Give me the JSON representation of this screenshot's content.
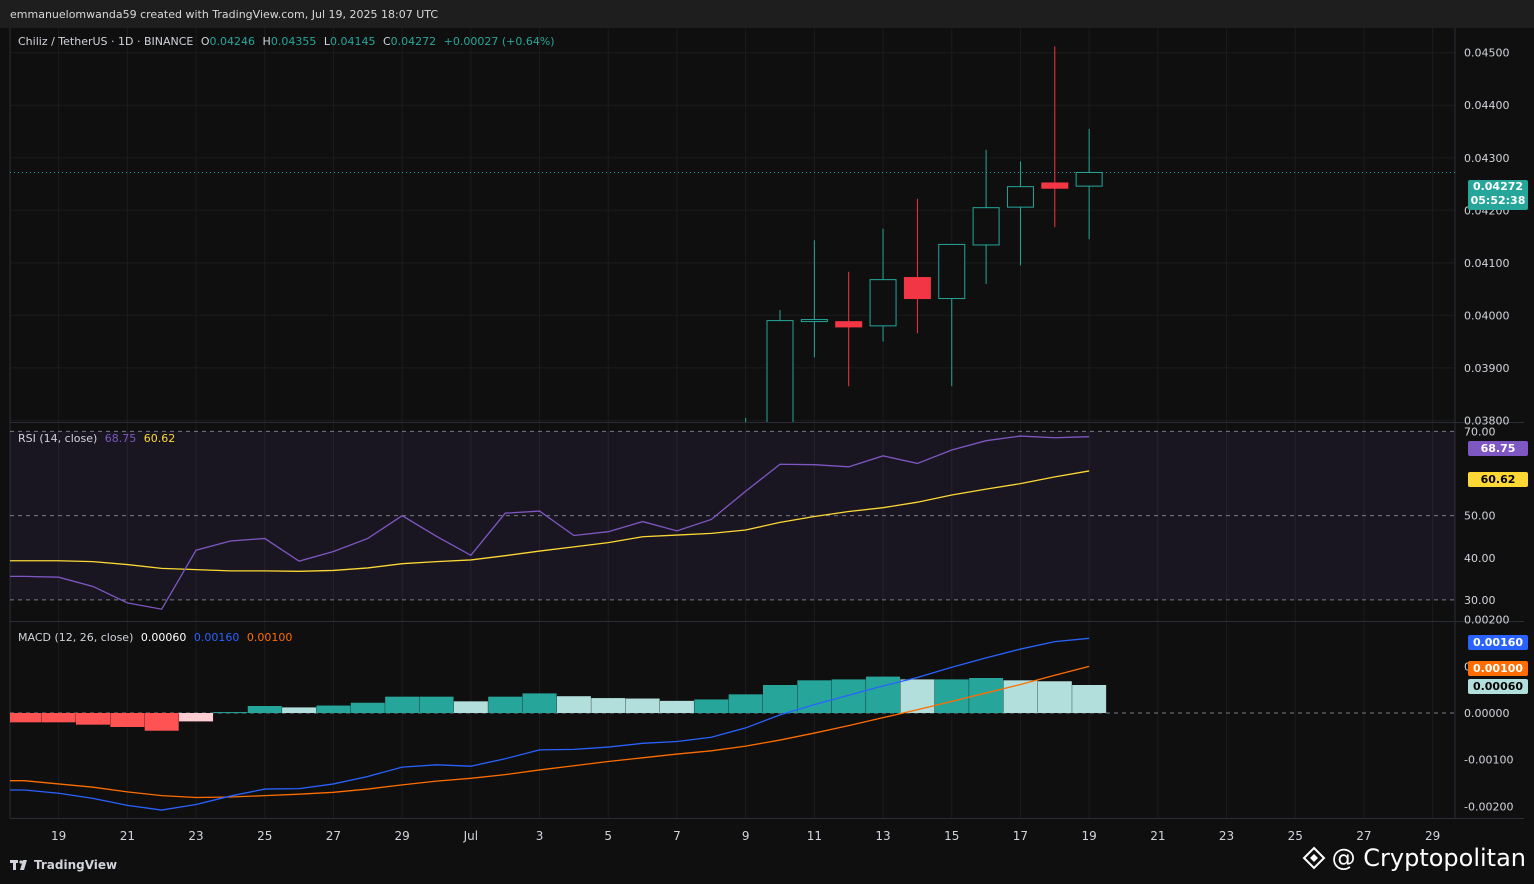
{
  "header": {
    "credit": "emmanuelomwanda59 created with TradingView.com, Jul 19, 2025 18:07 UTC"
  },
  "price_legend": {
    "symbol": "Chiliz / TetherUS · 1D · BINANCE",
    "o_label": "O",
    "o": "0.04246",
    "h_label": "H",
    "h": "0.04355",
    "l_label": "L",
    "l": "0.04145",
    "c_label": "C",
    "c": "0.04272",
    "change": "+0.00027 (+0.64%)"
  },
  "rsi_legend": {
    "label": "RSI (14, close)",
    "rsi": "68.75",
    "ma": "60.62"
  },
  "macd_legend": {
    "label": "MACD (12, 26, close)",
    "hist": "0.00060",
    "macd": "0.00160",
    "signal": "0.00100"
  },
  "tags": {
    "price": "0.04272",
    "countdown": "05:52:38",
    "rsi": "68.75",
    "rsi_ma": "60.62",
    "macd": "0.00160",
    "signal": "0.00100",
    "hist": "0.00060"
  },
  "footer": {
    "tradingview": "TradingView",
    "watermark": "@ Cryptopolitan"
  },
  "colors": {
    "up": "#26a69a",
    "down": "#f23645",
    "rsi": "#7e57c2",
    "rsi_ma": "#fdd835",
    "macd": "#2962ff",
    "signal": "#ff6d00",
    "hist_up": "#26a69a",
    "hist_up_fade": "#b2dfdb",
    "hist_down": "#ff5252",
    "hist_down_fade": "#ffcdd2"
  },
  "chart_data": [
    {
      "type": "candlestick",
      "title": "Chiliz / TetherUS · 1D · BINANCE",
      "x_ticks": [
        "19",
        "21",
        "23",
        "25",
        "27",
        "29",
        "Jul",
        "3",
        "5",
        "7",
        "9",
        "11",
        "13",
        "15",
        "17",
        "19",
        "21",
        "23",
        "25",
        "27",
        "29"
      ],
      "y_ticks": [
        "0.03800",
        "0.03900",
        "0.04000",
        "0.04100",
        "0.04200",
        "0.04300",
        "0.04400",
        "0.04500"
      ],
      "ylim": [
        0.03797,
        0.04547
      ],
      "candles": [
        {
          "date": "Jul 9",
          "o": 0.0368,
          "h": 0.03805,
          "l": 0.0366,
          "c": 0.0378
        },
        {
          "date": "Jul 10",
          "o": 0.0378,
          "h": 0.0401,
          "l": 0.0375,
          "c": 0.0399
        },
        {
          "date": "Jul 11",
          "o": 0.0399,
          "h": 0.04143,
          "l": 0.0392,
          "c": 0.03992
        },
        {
          "date": "Jul 12",
          "o": 0.03988,
          "h": 0.04083,
          "l": 0.03865,
          "c": 0.03978
        },
        {
          "date": "Jul 13",
          "o": 0.0398,
          "h": 0.04165,
          "l": 0.0395,
          "c": 0.04068
        },
        {
          "date": "Jul 14",
          "o": 0.04072,
          "h": 0.04222,
          "l": 0.03966,
          "c": 0.04032
        },
        {
          "date": "Jul 15",
          "o": 0.04032,
          "h": 0.04135,
          "l": 0.03865,
          "c": 0.04135
        },
        {
          "date": "Jul 16",
          "o": 0.04134,
          "h": 0.04315,
          "l": 0.0406,
          "c": 0.04205
        },
        {
          "date": "Jul 17",
          "o": 0.04206,
          "h": 0.04293,
          "l": 0.04095,
          "c": 0.04245
        },
        {
          "date": "Jul 18",
          "o": 0.04252,
          "h": 0.04512,
          "l": 0.04168,
          "c": 0.04242
        },
        {
          "date": "Jul 19",
          "o": 0.04246,
          "h": 0.04355,
          "l": 0.04145,
          "c": 0.04272
        }
      ],
      "last_price": 0.04272
    },
    {
      "type": "line",
      "title": "RSI (14, close)",
      "y_ticks": [
        "30.00",
        "40.00",
        "50.00",
        "70.00"
      ],
      "ylim": [
        25,
        72
      ],
      "bands": [
        30,
        50,
        70
      ],
      "categories": [
        "Jun 18",
        "Jun 19",
        "Jun 20",
        "Jun 21",
        "Jun 22",
        "Jun 23",
        "Jun 24",
        "Jun 25",
        "Jun 26",
        "Jun 27",
        "Jun 28",
        "Jun 29",
        "Jun 30",
        "Jul 1",
        "Jul 2",
        "Jul 3",
        "Jul 4",
        "Jul 5",
        "Jul 6",
        "Jul 7",
        "Jul 8",
        "Jul 9",
        "Jul 10",
        "Jul 11",
        "Jul 12",
        "Jul 13",
        "Jul 14",
        "Jul 15",
        "Jul 16",
        "Jul 17",
        "Jul 18",
        "Jul 19"
      ],
      "series": [
        {
          "name": "RSI",
          "values": [
            35.6,
            35.4,
            33.2,
            29.3,
            27.8,
            41.8,
            44.0,
            44.6,
            39.2,
            41.5,
            44.6,
            50.0,
            45.1,
            40.6,
            50.6,
            51.1,
            45.3,
            46.2,
            48.6,
            46.4,
            49.1,
            55.8,
            62.2,
            62.1,
            61.6,
            64.2,
            62.4,
            65.6,
            67.8,
            68.9,
            68.5,
            68.75
          ]
        },
        {
          "name": "MA",
          "values": [
            39.3,
            39.3,
            39.1,
            38.4,
            37.5,
            37.2,
            36.9,
            36.9,
            36.8,
            37.0,
            37.6,
            38.6,
            39.1,
            39.5,
            40.5,
            41.6,
            42.6,
            43.6,
            45.0,
            45.4,
            45.8,
            46.6,
            48.4,
            49.8,
            51.0,
            51.9,
            53.2,
            54.9,
            56.3,
            57.6,
            59.2,
            60.62
          ]
        }
      ]
    },
    {
      "type": "bar",
      "title": "MACD (12, 26, close)",
      "y_ticks": [
        "-0.00200",
        "-0.00100",
        "0.00000",
        "0.00100",
        "0.00200"
      ],
      "ylim": [
        -0.00225,
        0.00195
      ],
      "categories": [
        "Jun 18",
        "Jun 19",
        "Jun 20",
        "Jun 21",
        "Jun 22",
        "Jun 23",
        "Jun 24",
        "Jun 25",
        "Jun 26",
        "Jun 27",
        "Jun 28",
        "Jun 29",
        "Jun 30",
        "Jul 1",
        "Jul 2",
        "Jul 3",
        "Jul 4",
        "Jul 5",
        "Jul 6",
        "Jul 7",
        "Jul 8",
        "Jul 9",
        "Jul 10",
        "Jul 11",
        "Jul 12",
        "Jul 13",
        "Jul 14",
        "Jul 15",
        "Jul 16",
        "Jul 17",
        "Jul 18",
        "Jul 19"
      ],
      "series": [
        {
          "name": "Histogram",
          "values": [
            -0.0002,
            -0.0002,
            -0.00025,
            -0.0003,
            -0.00038,
            -0.00018,
            2e-05,
            0.00015,
            0.00012,
            0.00016,
            0.00022,
            0.00035,
            0.00035,
            0.00025,
            0.00035,
            0.00042,
            0.00036,
            0.00032,
            0.00031,
            0.00026,
            0.00029,
            0.0004,
            0.0006,
            0.0007,
            0.00072,
            0.00078,
            0.00072,
            0.00072,
            0.00075,
            0.0007,
            0.00068,
            0.0006
          ]
        },
        {
          "name": "MACD",
          "values": [
            -0.00165,
            -0.00172,
            -0.00183,
            -0.00198,
            -0.00208,
            -0.00196,
            -0.00178,
            -0.00163,
            -0.00162,
            -0.00152,
            -0.00136,
            -0.00116,
            -0.00111,
            -0.00114,
            -0.00098,
            -0.00079,
            -0.00078,
            -0.00073,
            -0.00065,
            -0.00061,
            -0.00052,
            -0.00032,
            -4e-05,
            0.00018,
            0.00038,
            0.00058,
            0.00076,
            0.00098,
            0.00118,
            0.00137,
            0.00153,
            0.0016
          ]
        },
        {
          "name": "Signal",
          "values": [
            -0.00145,
            -0.00152,
            -0.00159,
            -0.00169,
            -0.00177,
            -0.00181,
            -0.0018,
            -0.00177,
            -0.00174,
            -0.0017,
            -0.00163,
            -0.00154,
            -0.00146,
            -0.0014,
            -0.00132,
            -0.00122,
            -0.00113,
            -0.00104,
            -0.00096,
            -0.00088,
            -0.00081,
            -0.00071,
            -0.00058,
            -0.00043,
            -0.00027,
            -0.0001,
            7e-05,
            0.00025,
            0.00043,
            0.00061,
            0.00081,
            0.001
          ]
        }
      ]
    }
  ]
}
